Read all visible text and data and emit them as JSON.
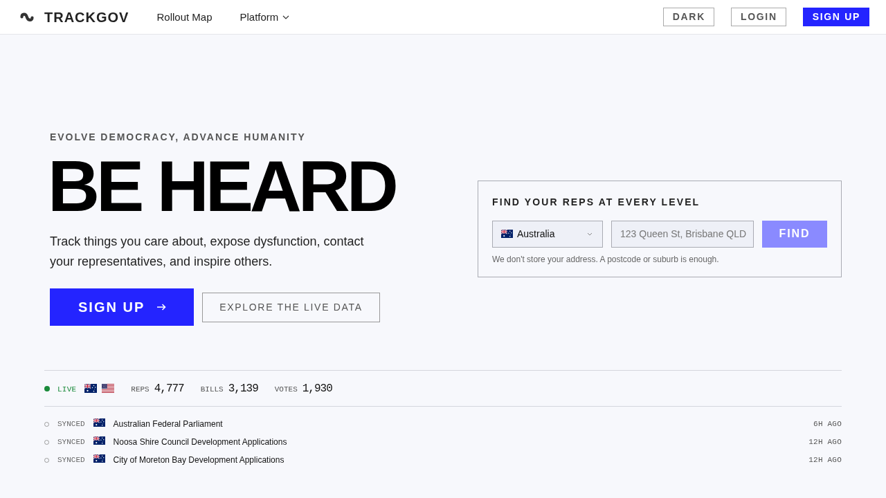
{
  "navbar": {
    "brand": "TRACKGOV",
    "links": [
      {
        "label": "Rollout Map",
        "kind": "link"
      },
      {
        "label": "Platform",
        "kind": "dropdown"
      }
    ],
    "actions": [
      {
        "label": "DARK",
        "kind": "outline"
      },
      {
        "label": "LOGIN",
        "kind": "outline"
      },
      {
        "label": "SIGN UP",
        "kind": "primary"
      }
    ]
  },
  "hero": {
    "eyebrow": "EVOLVE DEMOCRACY, ADVANCE HUMANITY",
    "title": "BE HEARD",
    "description": "Track things you care about, expose dysfunction, contact your representatives, and inspire others.",
    "buttons": [
      {
        "label": "SIGN UP",
        "kind": "primary"
      },
      {
        "label": "EXPLORE THE LIVE DATA",
        "kind": "outline"
      }
    ]
  },
  "finder": {
    "title": "FIND YOUR REPS AT EVERY LEVEL",
    "country": {
      "value": "Australia",
      "flag": {
        "kind": "au"
      }
    },
    "address": {
      "placeholder": "123 Queen St, Brisbane QLD"
    },
    "button": {
      "label": "FIND",
      "disabled": true
    },
    "note": "We don't store your address. A postcode or suburb is enough."
  },
  "live": {
    "label": "LIVE",
    "flags": [
      {
        "kind": "au"
      },
      {
        "kind": "us"
      }
    ],
    "stats": [
      {
        "label": "REPS",
        "value": "4,777"
      },
      {
        "label": "BILLS",
        "value": "3,139"
      },
      {
        "label": "VOTES",
        "value": "1,930"
      }
    ]
  },
  "sources": [
    {
      "status": "SYNCED",
      "flag": {
        "kind": "au"
      },
      "name": "Australian Federal Parliament",
      "age": "6H AGO"
    },
    {
      "status": "SYNCED",
      "flag": {
        "kind": "au"
      },
      "name": "Noosa Shire Council Development Applications",
      "age": "12H AGO"
    },
    {
      "status": "SYNCED",
      "flag": {
        "kind": "au"
      },
      "name": "City of Moreton Bay Development Applications",
      "age": "12H AGO"
    }
  ]
}
